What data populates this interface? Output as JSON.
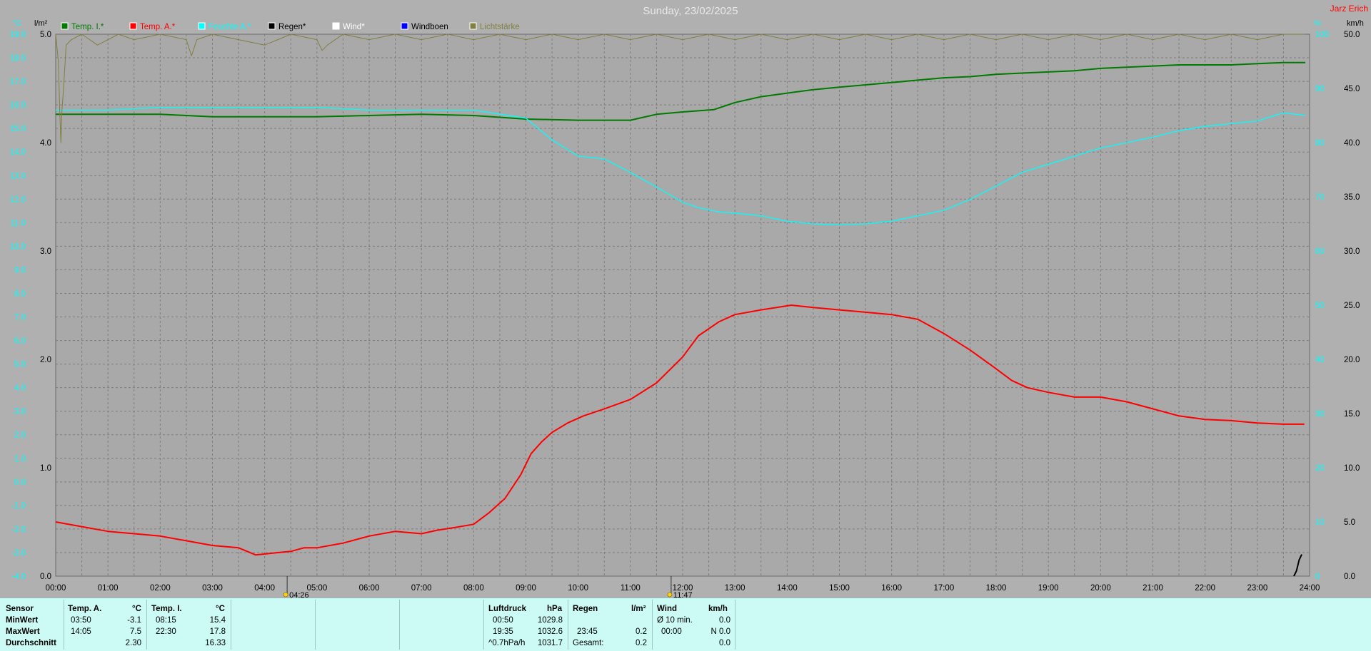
{
  "chart_data": {
    "type": "line",
    "title": "Sunday, 23/02/2025",
    "author": "Jarz Erich",
    "xlabel": "",
    "x_ticks": [
      "00:00",
      "01:00",
      "02:00",
      "03:00",
      "04:00",
      "05:00",
      "06:00",
      "07:00",
      "08:00",
      "09:00",
      "10:00",
      "11:00",
      "12:00",
      "13:00",
      "14:00",
      "15:00",
      "16:00",
      "17:00",
      "18:00",
      "19:00",
      "20:00",
      "21:00",
      "22:00",
      "23:00",
      "24:00"
    ],
    "x_range_hours": [
      0,
      24
    ],
    "axes": {
      "temp": {
        "unit": "°C",
        "range": [
          -4,
          19
        ],
        "ticks": [
          "19.0",
          "18.0",
          "17.0",
          "16.0",
          "15.0",
          "14.0",
          "13.0",
          "12.0",
          "11.0",
          "10.0",
          "9.0",
          "8.0",
          "7.0",
          "6.0",
          "5.0",
          "4.0",
          "3.0",
          "2.0",
          "1.0",
          "0.0",
          "-1.0",
          "-2.0",
          "-3.0",
          "-4.0"
        ]
      },
      "rain": {
        "unit": "l/m²",
        "range": [
          0,
          5
        ],
        "ticks": [
          "5.0",
          "4.0",
          "3.0",
          "2.0",
          "1.0",
          "0.0"
        ]
      },
      "humidity": {
        "unit": "%",
        "range": [
          0,
          100
        ],
        "ticks": [
          "100",
          "90",
          "80",
          "70",
          "60",
          "50",
          "40",
          "30",
          "20",
          "10",
          "0"
        ]
      },
      "wind": {
        "unit": "km/h",
        "range": [
          0,
          50
        ],
        "ticks": [
          "50.0",
          "45.0",
          "40.0",
          "35.0",
          "30.0",
          "25.0",
          "20.0",
          "15.0",
          "10.0",
          "5.0",
          "0.0"
        ]
      }
    },
    "grid": true,
    "legend_placement": "top",
    "legend": [
      {
        "label": "Temp. I.*",
        "color": "#007a00"
      },
      {
        "label": "Temp. A.*",
        "color": "#ff0000"
      },
      {
        "label": "Feuchte A.*",
        "color": "#00ffff"
      },
      {
        "label": "Regen*",
        "color": "#000000"
      },
      {
        "label": "Wind*",
        "color": "#ffffff"
      },
      {
        "label": "Windboen",
        "color": "#0000ff"
      },
      {
        "label": "Lichtstärke",
        "color": "#808040"
      }
    ],
    "markers": [
      {
        "label": "04:26",
        "hour": 4.43
      },
      {
        "label": "11:47",
        "hour": 11.78
      }
    ],
    "series": [
      {
        "name": "Temp. I.*",
        "axis": "temp",
        "color": "#007a00",
        "x": [
          0,
          1,
          2,
          2.5,
          3,
          4,
          5,
          6,
          7,
          8,
          9,
          10,
          11,
          11.5,
          12,
          12.6,
          13,
          13.5,
          14,
          14.5,
          15,
          15.5,
          16,
          16.5,
          17,
          17.5,
          18,
          18.5,
          19,
          19.5,
          20,
          20.5,
          21,
          21.5,
          22,
          22.5,
          23,
          23.5,
          23.92
        ],
        "y": [
          15.6,
          15.6,
          15.6,
          15.55,
          15.5,
          15.5,
          15.5,
          15.55,
          15.6,
          15.55,
          15.4,
          15.35,
          15.35,
          15.6,
          15.7,
          15.8,
          16.1,
          16.35,
          16.5,
          16.65,
          16.75,
          16.85,
          16.95,
          17.05,
          17.15,
          17.2,
          17.3,
          17.35,
          17.4,
          17.45,
          17.55,
          17.6,
          17.65,
          17.7,
          17.7,
          17.7,
          17.75,
          17.8,
          17.8
        ]
      },
      {
        "name": "Temp. A.*",
        "axis": "temp",
        "color": "#ff0000",
        "x": [
          0,
          0.5,
          1,
          1.5,
          2,
          2.5,
          3,
          3.5,
          3.83,
          4.25,
          4.5,
          4.75,
          5,
          5.5,
          6,
          6.5,
          7,
          7.3,
          7.6,
          8,
          8.3,
          8.6,
          8.9,
          9.1,
          9.3,
          9.5,
          9.8,
          10.1,
          10.5,
          11,
          11.5,
          12,
          12.3,
          12.7,
          13,
          13.5,
          14.08,
          14.5,
          15,
          15.5,
          16,
          16.5,
          17,
          17.5,
          18,
          18.3,
          18.6,
          19,
          19.5,
          20,
          20.5,
          21,
          21.5,
          22,
          22.5,
          23,
          23.5,
          23.9
        ],
        "y": [
          -1.7,
          -1.9,
          -2.1,
          -2.2,
          -2.3,
          -2.5,
          -2.7,
          -2.8,
          -3.1,
          -3.0,
          -2.95,
          -2.8,
          -2.8,
          -2.6,
          -2.3,
          -2.1,
          -2.2,
          -2.05,
          -1.95,
          -1.8,
          -1.3,
          -0.7,
          0.3,
          1.2,
          1.7,
          2.1,
          2.5,
          2.8,
          3.1,
          3.5,
          4.2,
          5.3,
          6.2,
          6.8,
          7.1,
          7.3,
          7.5,
          7.4,
          7.3,
          7.2,
          7.1,
          6.9,
          6.3,
          5.6,
          4.8,
          4.3,
          4.0,
          3.8,
          3.6,
          3.6,
          3.4,
          3.1,
          2.8,
          2.65,
          2.6,
          2.5,
          2.45,
          2.45
        ]
      },
      {
        "name": "Feuchte A.*",
        "axis": "humidity",
        "color": "#00ffff",
        "x": [
          0,
          1,
          2,
          3,
          4,
          5,
          6,
          7,
          8,
          9,
          9.5,
          10,
          10.5,
          11,
          11.5,
          12,
          12.3,
          12.7,
          13,
          13.5,
          14,
          14.5,
          15,
          15.5,
          16,
          16.5,
          17,
          17.5,
          18,
          18.5,
          19,
          19.5,
          20,
          20.5,
          21,
          21.5,
          22,
          22.5,
          23,
          23.5,
          23.92
        ],
        "y": [
          86,
          86,
          86.5,
          86.5,
          86.5,
          86.5,
          86,
          86,
          86,
          84.5,
          80.5,
          77.5,
          77,
          74.5,
          71.8,
          69,
          68,
          67.2,
          67,
          66.5,
          65.5,
          65,
          64.8,
          65,
          65.5,
          66.5,
          67.5,
          69.5,
          72,
          74.5,
          76,
          77.5,
          79,
          80,
          81,
          82.2,
          83,
          83.5,
          84,
          85.5,
          85
        ]
      },
      {
        "name": "Regen*",
        "axis": "rain",
        "color": "#000000",
        "x": [
          23.7,
          23.75,
          23.8,
          23.85
        ],
        "y": [
          0,
          0.05,
          0.15,
          0.2
        ]
      },
      {
        "name": "Lichtstärke",
        "axis": "humidity",
        "color": "#808040",
        "x": [
          0,
          0.05,
          0.08,
          0.1,
          0.12,
          0.15,
          0.2,
          0.3,
          0.5,
          0.8,
          1.2,
          1.5,
          2,
          2.5,
          2.6,
          2.7,
          3,
          3.5,
          4,
          4.5,
          5,
          5.1,
          5.2,
          5.5,
          6,
          6.5,
          7,
          7.5,
          8,
          8.5,
          9,
          9.5,
          10,
          10.5,
          11,
          11.5,
          12,
          12.5,
          13,
          13.5,
          14,
          14.5,
          15,
          15.5,
          16,
          16.5,
          17,
          17.5,
          18,
          18.5,
          19,
          19.5,
          20,
          20.5,
          21,
          21.5,
          22,
          22.5,
          23,
          23.5,
          23.9
        ],
        "y": [
          100,
          95,
          85,
          80,
          86,
          90,
          98,
          99,
          100,
          98,
          100,
          99,
          100,
          99,
          96,
          99,
          100,
          99,
          98,
          100,
          99,
          97,
          98,
          100,
          99,
          100,
          99,
          100,
          99,
          100,
          99,
          100,
          99,
          100,
          99,
          100,
          99,
          100,
          99,
          100,
          99,
          100,
          99,
          100,
          99,
          100,
          99,
          100,
          99,
          100,
          99,
          100,
          99,
          100,
          99,
          100,
          99,
          100,
          99,
          100,
          100
        ]
      }
    ]
  },
  "summary": {
    "row_labels": {
      "sensor": "Sensor",
      "min": "MinWert",
      "max": "MaxWert",
      "avg": "Durchschnitt"
    },
    "temp_a": {
      "header": "Temp. A.",
      "unit": "°C",
      "min_time": "03:50",
      "min_val": "-3.1",
      "max_time": "14:05",
      "max_val": "7.5",
      "avg": "2.30"
    },
    "temp_i": {
      "header": "Temp. I.",
      "unit": "°C",
      "min_time": "08:15",
      "min_val": "15.4",
      "max_time": "22:30",
      "max_val": "17.8",
      "avg": "16.33"
    },
    "pressure": {
      "header": "Luftdruck",
      "unit": "hPa",
      "min_time": "00:50",
      "min_val": "1029.8",
      "max_time": "19:35",
      "max_val": "1032.6",
      "trend_label": "^0.7hPa/h",
      "trend_val": "1031.7"
    },
    "rain": {
      "header": "Regen",
      "unit": "l/m²",
      "max_time": "23:45",
      "max_val": "0.2",
      "total_label": "Gesamt:",
      "total_val": "0.2"
    },
    "wind": {
      "header": "Wind",
      "unit": "km/h",
      "r1_label": "Ø 10 min.",
      "r1_val": "0.0",
      "r2_time": "00:00",
      "r2_val": "N 0.0",
      "r3_val": "0.0"
    }
  }
}
